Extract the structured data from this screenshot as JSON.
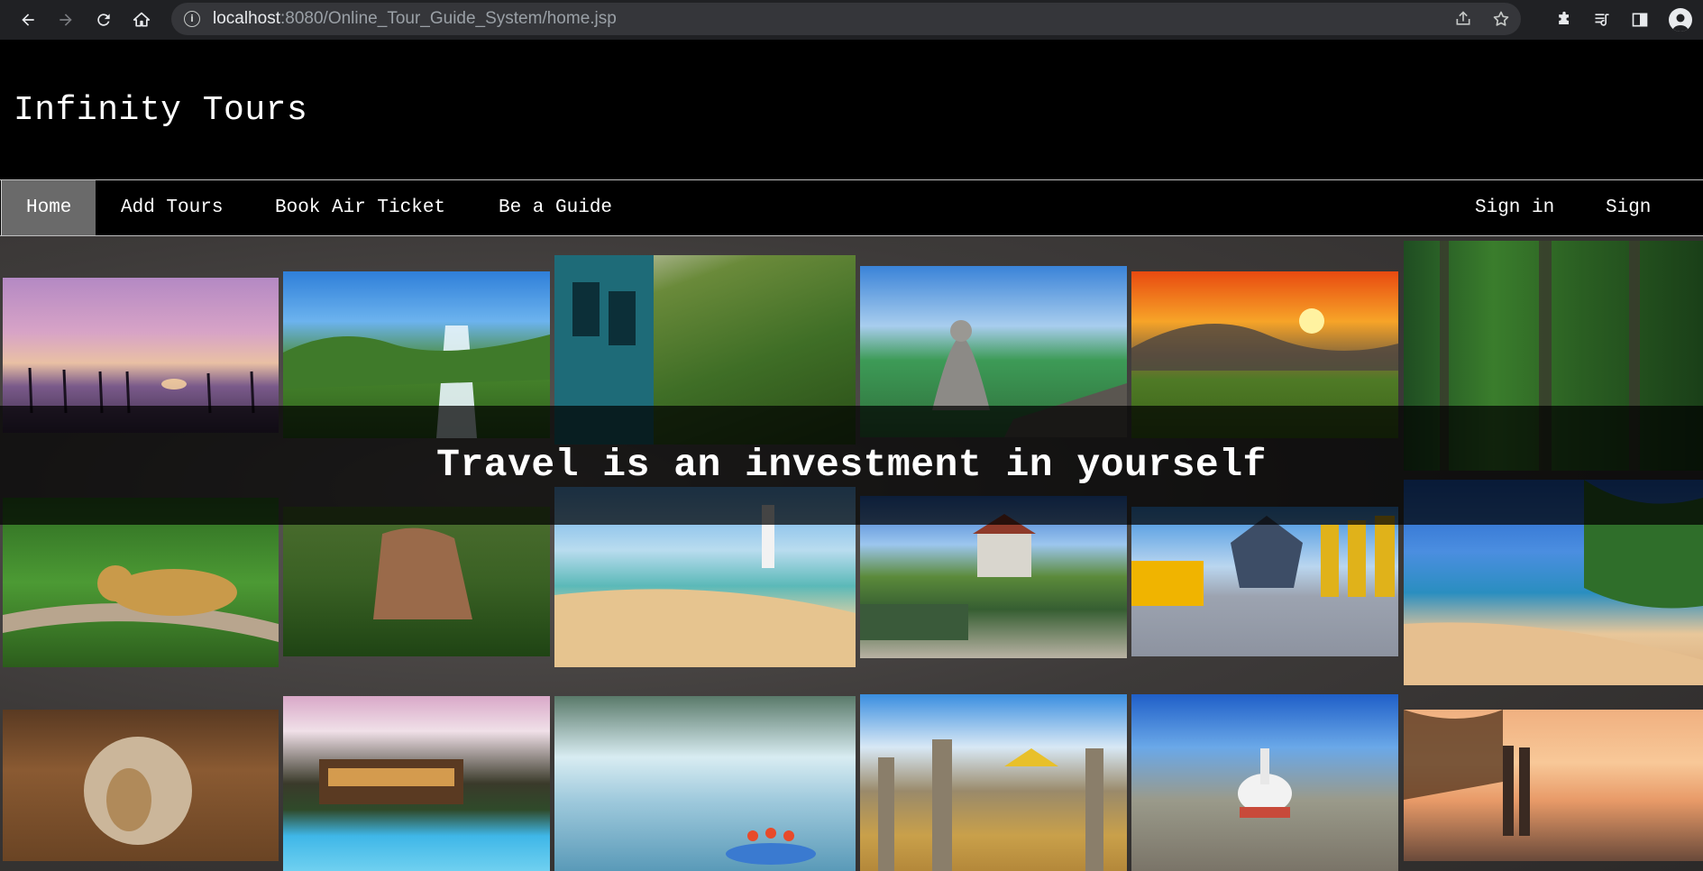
{
  "browser": {
    "url_host": "localhost",
    "url_rest": ":8080/Online_Tour_Guide_System/home.jsp"
  },
  "site": {
    "title": "Infinity Tours"
  },
  "nav": {
    "items": [
      {
        "label": "Home",
        "active": true
      },
      {
        "label": "Add Tours"
      },
      {
        "label": "Book Air Ticket"
      },
      {
        "label": "Be a Guide"
      }
    ],
    "right_items": [
      {
        "label": "Sign in"
      },
      {
        "label": "Sign up"
      }
    ]
  },
  "hero": {
    "tagline": "Travel is an investment in yourself"
  },
  "gallery": {
    "photos": [
      {
        "name": "stilt-fishermen-photo"
      },
      {
        "name": "waterfall-mountain-photo"
      },
      {
        "name": "train-hillside-photo"
      },
      {
        "name": "buddha-statues-lake-photo"
      },
      {
        "name": "tea-hills-sunset-photo"
      },
      {
        "name": "rainforest-photo"
      },
      {
        "name": "leopard-photo"
      },
      {
        "name": "sigiriya-rock-photo"
      },
      {
        "name": "lighthouse-beach-photo"
      },
      {
        "name": "temple-of-tooth-photo"
      },
      {
        "name": "golden-buddha-temple-photo"
      },
      {
        "name": "palm-beach-photo"
      },
      {
        "name": "cave-temple-buddha-photo"
      },
      {
        "name": "resort-pool-photo"
      },
      {
        "name": "river-rafting-photo"
      },
      {
        "name": "ancient-pillars-photo"
      },
      {
        "name": "stupa-photo"
      },
      {
        "name": "surfers-sunset-photo"
      }
    ]
  },
  "colors": {
    "header_bg": "#000000",
    "nav_active_bg": "#6a6a6a",
    "text": "#ffffff"
  }
}
